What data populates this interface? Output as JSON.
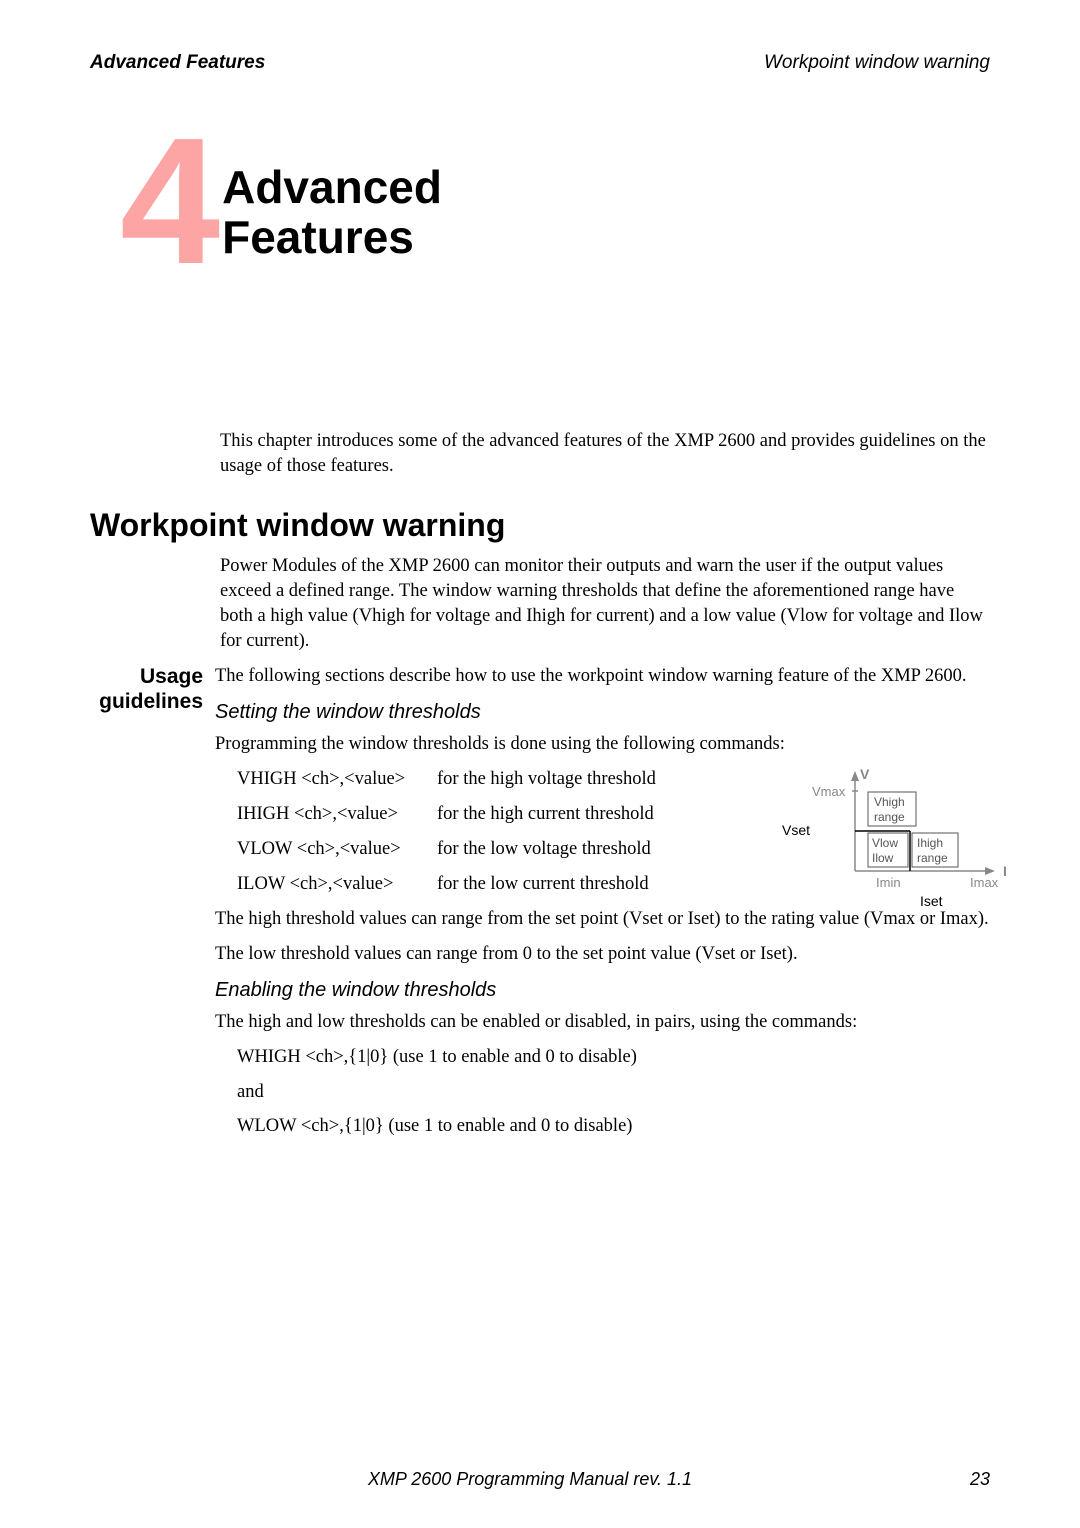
{
  "header": {
    "left": "Advanced Features",
    "right": "Workpoint window warning"
  },
  "chapter": {
    "number": "4",
    "title_line1": "Advanced",
    "title_line2": "Features"
  },
  "intro": "This chapter introduces some of the advanced features of the XMP 2600 and provides guidelines on the usage of those features.",
  "section1": {
    "heading": "Workpoint window warning",
    "para1": "Power Modules of the XMP 2600 can monitor their outputs and warn the user if the output values exceed a defined range. The window warning thresholds that define the aforementioned range have both a high value (Vhigh for voltage and Ihigh for current) and a low value (Vlow for voltage and Ilow for current).",
    "usage_label_l1": "Usage",
    "usage_label_l2": "guidelines",
    "usage_para": "The following sections describe how to use the workpoint window warning feature of the XMP 2600.",
    "sub1": {
      "heading": "Setting the window thresholds",
      "intro": "Programming the window thresholds is done using the following commands:",
      "commands": [
        {
          "name": "VHIGH <ch>,<value>",
          "desc": "for the high voltage threshold"
        },
        {
          "name": "IHIGH <ch>,<value>",
          "desc": "for the high current threshold"
        },
        {
          "name": "VLOW <ch>,<value>",
          "desc": "for the low voltage threshold"
        },
        {
          "name": "ILOW <ch>,<value>",
          "desc": "for the low current threshold"
        }
      ],
      "after1": "The high threshold values can range from the set point (Vset or Iset) to the rating value (Vmax or Imax).",
      "after2": "The low threshold values can range from 0 to the set point value (Vset or Iset)."
    },
    "sub2": {
      "heading": "Enabling the window thresholds",
      "intro": "The high and low thresholds can be enabled or disabled, in pairs, using the commands:",
      "line1": "WHIGH <ch>,{1|0} (use 1 to enable and 0 to disable)",
      "and": "and",
      "line2": "WLOW <ch>,{1|0}  (use 1 to enable and 0 to disable)"
    }
  },
  "diagram": {
    "V": "V",
    "Vmax": "Vmax",
    "Vset": "Vset",
    "Vhigh": "Vhigh",
    "range1": "range",
    "Vlow": "Vlow",
    "Ilow": "Ilow",
    "Ihigh": "Ihigh",
    "range2": "range",
    "Imin": "Imin",
    "Imax": "Imax",
    "Iset": "Iset",
    "I": "I"
  },
  "footer": {
    "center": "XMP 2600 Programming Manual rev. 1.1",
    "page": "23"
  }
}
